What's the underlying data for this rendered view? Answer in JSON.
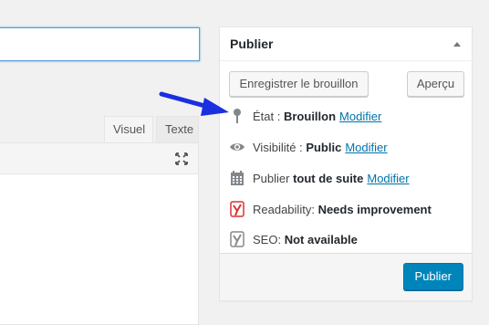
{
  "editor": {
    "tabs": [
      {
        "label": "Visuel"
      },
      {
        "label": "Texte"
      }
    ]
  },
  "publish_box": {
    "title": "Publier",
    "save_draft_label": "Enregistrer le brouillon",
    "preview_label": "Aperçu",
    "status": {
      "label": "État :",
      "value": "Brouillon",
      "action": "Modifier"
    },
    "visibility": {
      "label": "Visibilité :",
      "value": "Public",
      "action": "Modifier"
    },
    "schedule": {
      "label": "Publier",
      "value": "tout de suite",
      "action": "Modifier"
    },
    "readability": {
      "label": "Readability:",
      "value": "Needs improvement"
    },
    "seo": {
      "label": "SEO:",
      "value": "Not available"
    },
    "publish_label": "Publier"
  },
  "icons": {
    "status": "pin-icon",
    "visibility": "eye-icon",
    "schedule": "calendar-icon",
    "readability": "yoast-icon",
    "seo": "yoast-icon",
    "fullscreen": "fullscreen-icon",
    "toggle": "arrow-up-icon"
  },
  "colors": {
    "accent": "#0085ba",
    "link": "#0073aa",
    "yoast_red": "#dc3232",
    "yoast_grey": "#888888",
    "annotation_arrow": "#1a2fe0"
  }
}
